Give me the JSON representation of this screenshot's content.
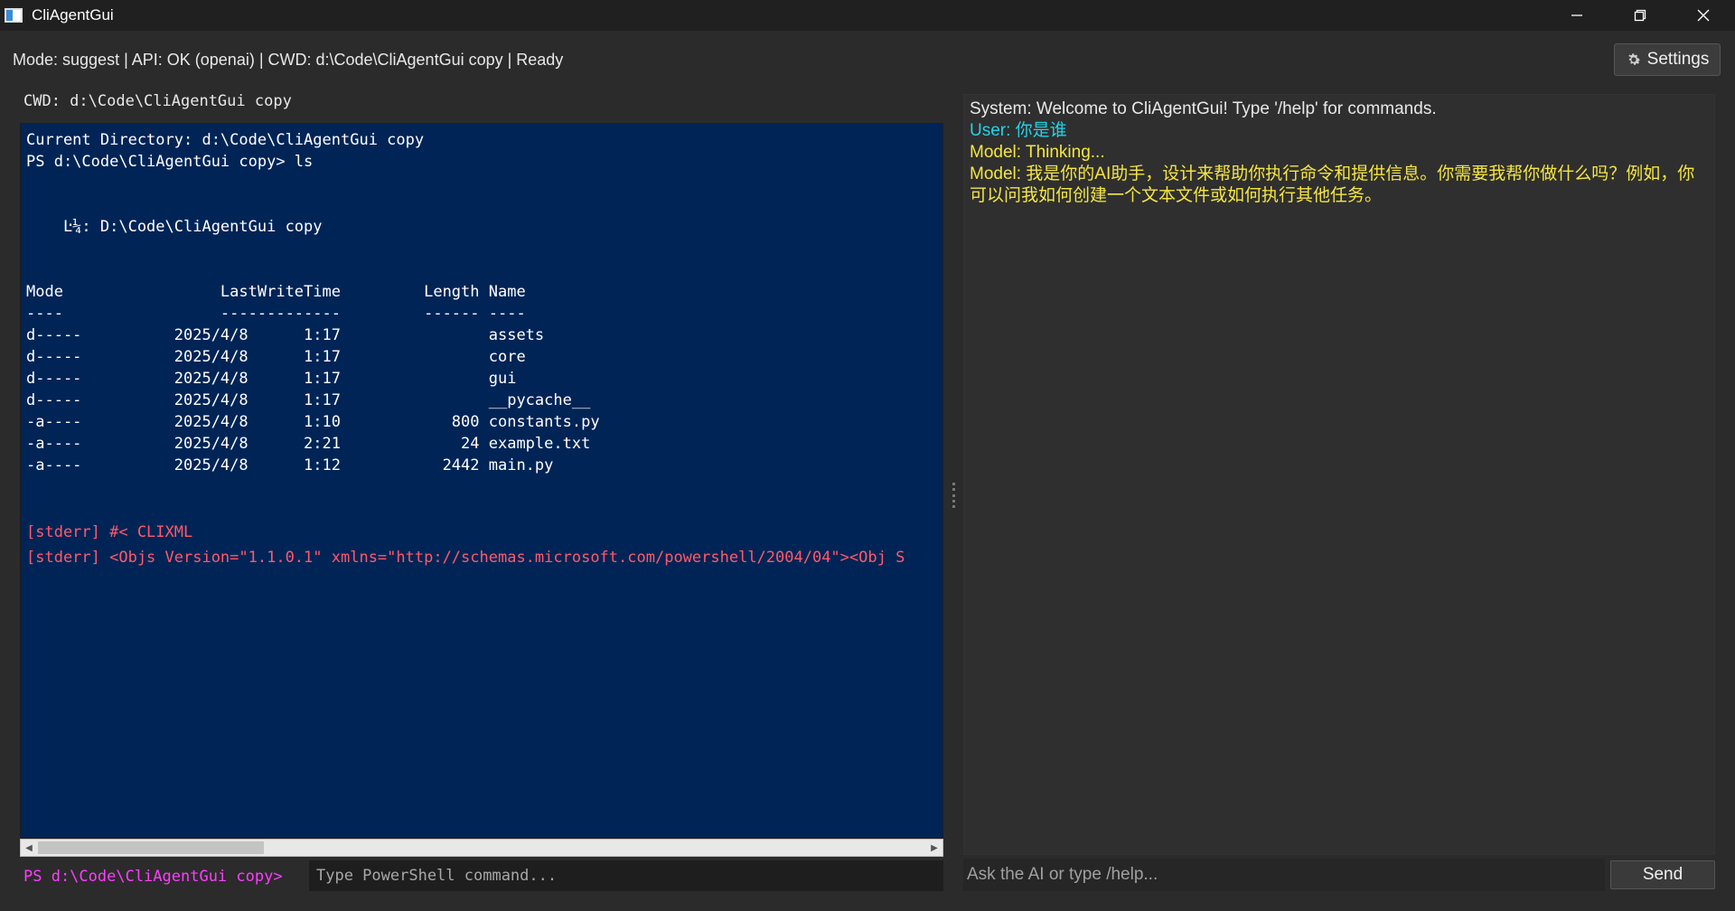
{
  "window": {
    "title": "CliAgentGui",
    "minimize_glyph": "—",
    "close_glyph": "✕"
  },
  "status": {
    "text": "Mode: suggest | API: OK (openai) | CWD: d:\\Code\\CliAgentGui copy | Ready",
    "settings_label": "Settings",
    "settings_icon": "gear-icon"
  },
  "terminal": {
    "cwd_label": "CWD: d:\\Code\\CliAgentGui copy",
    "background": "#012456",
    "lines": [
      "Current Directory: d:\\Code\\CliAgentGui copy",
      "PS d:\\Code\\CliAgentGui copy> ls",
      "",
      "",
      "    Ŀ¼: D:\\Code\\CliAgentGui copy",
      "",
      "",
      "Mode                 LastWriteTime         Length Name",
      "----                 -------------         ------ ----",
      "d-----          2025/4/8      1:17                assets",
      "d-----          2025/4/8      1:17                core",
      "d-----          2025/4/8      1:17                gui",
      "d-----          2025/4/8      1:17                __pycache__",
      "-a----          2025/4/8      1:10            800 constants.py",
      "-a----          2025/4/8      2:21             24 example.txt",
      "-a----          2025/4/8      1:12           2442 main.py",
      "",
      ""
    ],
    "stderr_lines": [
      "[stderr] #< CLIXML",
      "[stderr] <Objs Version=\"1.1.0.1\" xmlns=\"http://schemas.microsoft.com/powershell/2004/04\"><Obj S"
    ],
    "prompt": "PS d:\\Code\\CliAgentGui copy>",
    "input_placeholder": "Type PowerShell command...",
    "scroll_left": "◀",
    "scroll_right": "▶"
  },
  "chat": {
    "messages": [
      {
        "role": "system",
        "text": "System: Welcome to CliAgentGui! Type '/help' for commands."
      },
      {
        "role": "user",
        "text": "User: 你是谁"
      },
      {
        "role": "model",
        "text": "Model: Thinking..."
      },
      {
        "role": "model",
        "text": "Model: 我是你的AI助手，设计来帮助你执行命令和提供信息。你需要我帮你做什么吗？例如，你可以问我如何创建一个文本文件或如何执行其他任务。"
      }
    ],
    "input_placeholder": "Ask the AI or type /help...",
    "send_label": "Send"
  },
  "colors": {
    "system": "#e8e8e8",
    "user": "#22d3e8",
    "model": "#f5e642",
    "stderr": "#ff5a6a",
    "prompt": "#ff3dff"
  }
}
